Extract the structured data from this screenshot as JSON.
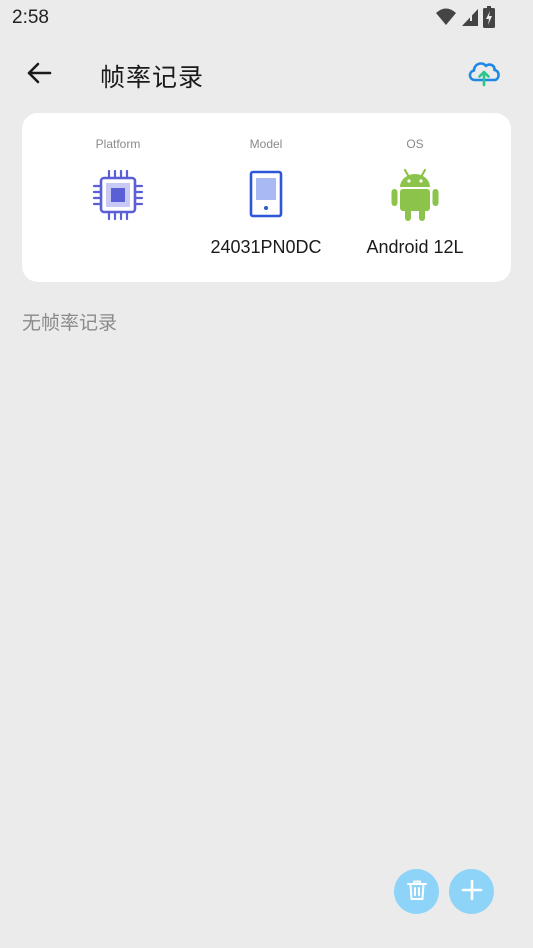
{
  "status_bar": {
    "time": "2:58",
    "icons": [
      "wifi-icon",
      "signal-icon",
      "battery-icon"
    ]
  },
  "app_bar": {
    "title": "帧率记录",
    "back_icon": "arrow-left-icon",
    "upload_icon": "cloud-upload-icon"
  },
  "device_info": {
    "platform": {
      "label": "Platform",
      "value": "",
      "icon": "chip-icon"
    },
    "model": {
      "label": "Model",
      "value": "24031PN0DC",
      "icon": "phone-icon"
    },
    "os": {
      "label": "OS",
      "value": "Android 12L",
      "icon": "android-icon"
    }
  },
  "records": {
    "empty_text": "无帧率记录"
  },
  "fabs": {
    "delete_icon": "trash-icon",
    "add_icon": "plus-icon"
  },
  "colors": {
    "background": "#ebebeb",
    "card": "#ffffff",
    "fab": "#8dd4f8",
    "chip": "#5b5fd6",
    "phone": "#2e57d8",
    "android": "#8cc34a",
    "cloud_blue": "#1e88e5",
    "cloud_green": "#2bc48a"
  }
}
